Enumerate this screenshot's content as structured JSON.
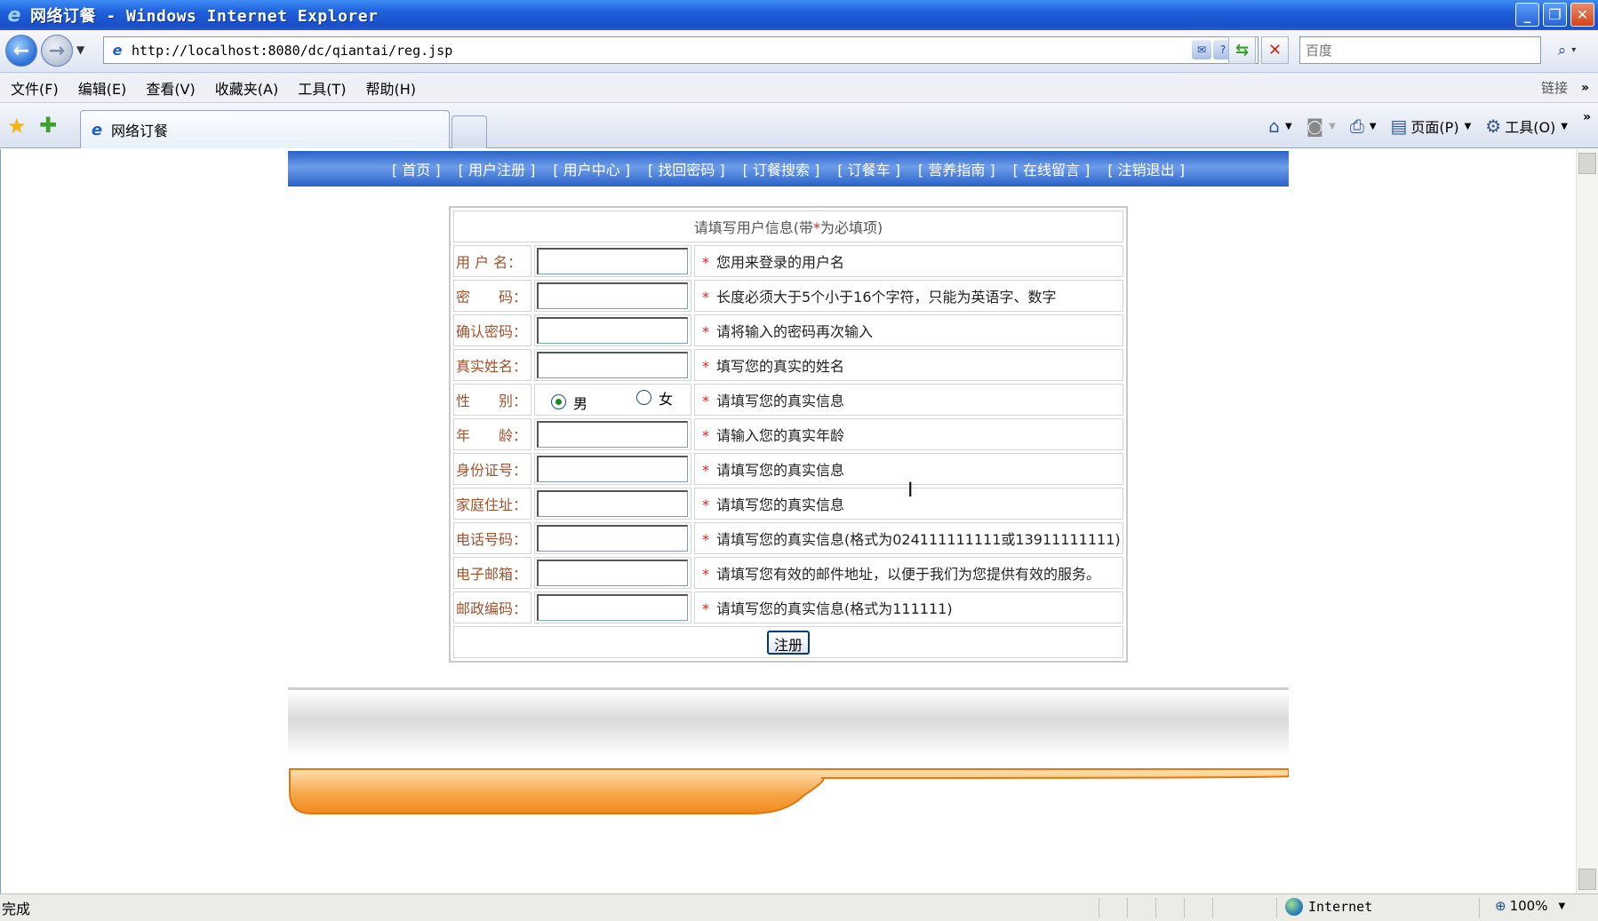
{
  "window": {
    "title": "网络订餐 - Windows Internet Explorer",
    "ie_icon": "ie-logo-icon",
    "buttons": {
      "minimize": "_",
      "maximize": "❐",
      "close": "✕"
    }
  },
  "address_bar": {
    "url": "http://localhost:8080/dc/qiantai/reg.jsp",
    "search_placeholder": "百度"
  },
  "menu": {
    "items": [
      "文件(F)",
      "编辑(E)",
      "查看(V)",
      "收藏夹(A)",
      "工具(T)",
      "帮助(H)"
    ],
    "links_label": "链接"
  },
  "tab": {
    "title": "网络订餐"
  },
  "command_bar": {
    "page_label": "页面(P)",
    "tools_label": "工具(O)"
  },
  "site_nav": {
    "items": [
      "首页",
      "用户注册",
      "用户中心",
      "找回密码",
      "订餐搜索",
      "订餐车",
      "营养指南",
      "在线留言",
      "注销退出"
    ]
  },
  "form": {
    "caption_prefix": "请填写用户信息(带",
    "caption_star": "*",
    "caption_suffix": "为必填项)",
    "required_mark": "*",
    "rows": [
      {
        "label": "用 户 名：",
        "value": "",
        "hint": "您用来登录的用户名"
      },
      {
        "label": "密　　码：",
        "value": "",
        "hint": "长度必须大于5个小于16个字符，只能为英语字、数字"
      },
      {
        "label": "确认密码：",
        "value": "",
        "hint": "请将输入的密码再次输入"
      },
      {
        "label": "真实姓名：",
        "value": "",
        "hint": "填写您的真实的姓名"
      },
      {
        "label": "性　　别：",
        "hint": "请填写您的真实信息"
      },
      {
        "label": "年　　龄：",
        "value": "",
        "hint": "请输入您的真实年龄"
      },
      {
        "label": "身份证号：",
        "value": "",
        "hint": "请填写您的真实信息"
      },
      {
        "label": "家庭住址：",
        "value": "",
        "hint": "请填写您的真实信息"
      },
      {
        "label": "电话号码：",
        "value": "",
        "hint": "请填写您的真实信息(格式为024111111111或13911111111)"
      },
      {
        "label": "电子邮箱：",
        "value": "",
        "hint": "请填写您有效的邮件地址，以便于我们为您提供有效的服务。"
      },
      {
        "label": "邮政编码：",
        "value": "",
        "hint": "请填写您的真实信息(格式为111111)"
      }
    ],
    "gender": {
      "male": "男",
      "female": "女",
      "selected": "男"
    },
    "submit_label": "注册"
  },
  "status_bar": {
    "text": "完成",
    "zone": "Internet",
    "zoom": "100%"
  },
  "colors": {
    "title_bar": "#1f5fdc",
    "nav_banner": "#2a62c7",
    "label": "#a0522d",
    "required": "#e02020",
    "footer_orange": "#f39a2b"
  }
}
